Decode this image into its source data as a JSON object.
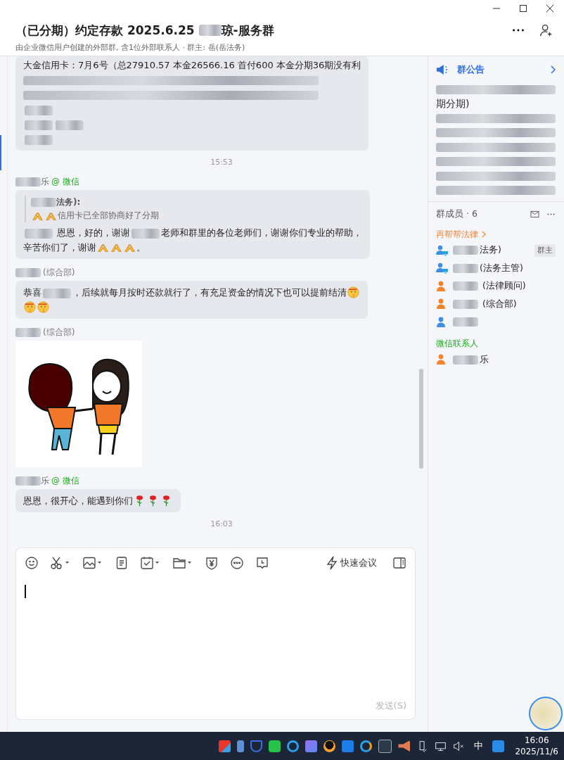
{
  "window": {
    "title_start": "（已分期）约定存款 2025.6.25 ",
    "title_end": "琼-服务群",
    "subtitle": "由企业微信用户创建的外部群, 含1位外部联系人 · 群主: 岳(岳法务)"
  },
  "messages": [
    {
      "kind": "text",
      "body": [
        {
          "kind": "text",
          "text": "大金信用卡：7月6号（总27910.57 本金26566.16 首付600 本金分期36期没有利"
        },
        {
          "kind": "break"
        },
        {
          "kind": "redacted-line"
        },
        {
          "kind": "break"
        },
        {
          "kind": "redacted-line"
        },
        {
          "kind": "break"
        },
        {
          "kind": "redacted"
        },
        {
          "kind": "break"
        },
        {
          "kind": "redacted"
        },
        {
          "kind": "redacted"
        },
        {
          "kind": "break"
        },
        {
          "kind": "redacted"
        }
      ]
    },
    {
      "kind": "time",
      "text": "15:53"
    },
    {
      "kind": "text",
      "sender": [
        {
          "kind": "redacted"
        },
        {
          "kind": "text",
          "text": "乐"
        }
      ],
      "tag": {
        "kind": "wechat",
        "text": "@ 微信"
      },
      "quote": {
        "author": [
          {
            "kind": "redacted"
          },
          {
            "kind": "text",
            "text": "法务):"
          }
        ],
        "text": [
          {
            "kind": "emoji-hands"
          },
          {
            "kind": "emoji-hands"
          },
          {
            "kind": "text",
            "text": "信用卡已全部协商好了分期"
          }
        ]
      },
      "body": [
        {
          "kind": "redacted"
        },
        {
          "kind": "text",
          "text": " 恩恩，好的，谢谢"
        },
        {
          "kind": "redacted"
        },
        {
          "kind": "text",
          "text": "老师和群里的各位老师们，谢谢你们专业的帮助，"
        },
        {
          "kind": "break"
        },
        {
          "kind": "text",
          "text": "辛苦你们了，谢谢"
        },
        {
          "kind": "emoji-hands"
        },
        {
          "kind": "emoji-hands"
        },
        {
          "kind": "emoji-hands"
        },
        {
          "kind": "text",
          "text": "。"
        }
      ]
    },
    {
      "kind": "text",
      "sender": [
        {
          "kind": "redacted"
        }
      ],
      "tag": {
        "kind": "dept",
        "text": "(综合部)"
      },
      "body": [
        {
          "kind": "text",
          "text": "恭喜"
        },
        {
          "kind": "redacted"
        },
        {
          "kind": "text",
          "text": "，后续就每月按时还款就行了，有充足资金的情况下也可以提前结清"
        },
        {
          "kind": "emoji-shush"
        },
        {
          "kind": "break"
        },
        {
          "kind": "emoji-shush"
        },
        {
          "kind": "emoji-shush"
        }
      ]
    },
    {
      "kind": "image",
      "sender": [
        {
          "kind": "redacted"
        }
      ],
      "tag": {
        "kind": "dept",
        "text": "(综合部)"
      }
    },
    {
      "kind": "text",
      "sender": [
        {
          "kind": "redacted"
        },
        {
          "kind": "text",
          "text": "乐"
        }
      ],
      "tag": {
        "kind": "wechat",
        "text": "@ 微信"
      },
      "body": [
        {
          "kind": "text",
          "text": "恩恩，很开心，能遇到你们"
        },
        {
          "kind": "emoji-rose"
        },
        {
          "kind": "emoji-rose"
        },
        {
          "kind": "emoji-rose"
        }
      ]
    },
    {
      "kind": "time",
      "text": "16:03"
    }
  ],
  "composer": {
    "quick_meeting": "快速会议",
    "send": "发送(S)"
  },
  "sidebar": {
    "notice_title": "群公告",
    "notice": [
      {
        "kind": "redacted-line"
      },
      {
        "kind": "break"
      },
      {
        "kind": "text",
        "text": "期分期)"
      },
      {
        "kind": "break"
      },
      {
        "kind": "redacted-line"
      },
      {
        "kind": "break"
      },
      {
        "kind": "redacted-line"
      },
      {
        "kind": "break"
      },
      {
        "kind": "redacted-line"
      },
      {
        "kind": "break"
      },
      {
        "kind": "redacted-line"
      },
      {
        "kind": "break"
      },
      {
        "kind": "redacted-line"
      },
      {
        "kind": "break"
      },
      {
        "kind": "redacted-line"
      }
    ],
    "members_title": "群成员 · 6",
    "groups": [
      {
        "title": "再帮帮法律",
        "kind": "company",
        "members": [
          {
            "kind": "staff",
            "parts": [
              {
                "kind": "redacted"
              },
              {
                "kind": "text",
                "text": "法务)"
              }
            ],
            "badge": "群主"
          },
          {
            "kind": "staff",
            "parts": [
              {
                "kind": "redacted"
              },
              {
                "kind": "text",
                "text": "(法务主管)"
              }
            ]
          },
          {
            "kind": "external",
            "parts": [
              {
                "kind": "redacted"
              },
              {
                "kind": "text",
                "text": " (法律顾问)"
              }
            ]
          },
          {
            "kind": "external",
            "parts": [
              {
                "kind": "redacted"
              },
              {
                "kind": "text",
                "text": " (综合部)"
              }
            ]
          },
          {
            "kind": "member",
            "parts": [
              {
                "kind": "redacted"
              }
            ]
          }
        ]
      },
      {
        "title": "微信联系人",
        "kind": "wechat",
        "members": [
          {
            "kind": "external",
            "parts": [
              {
                "kind": "redacted"
              },
              {
                "kind": "text",
                "text": "乐"
              }
            ]
          }
        ]
      }
    ]
  },
  "taskbar": {
    "ime": "中",
    "time": "16:06",
    "date": "2025/11/6"
  }
}
